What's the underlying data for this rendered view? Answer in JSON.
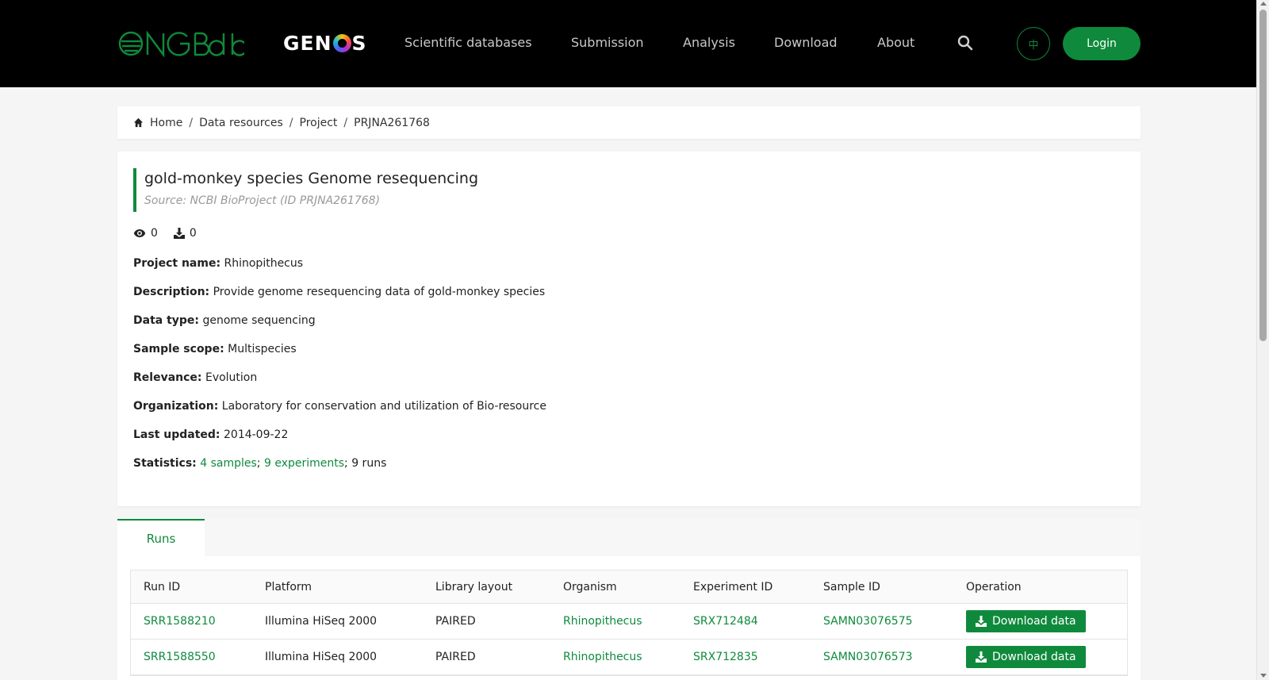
{
  "header": {
    "logo_text": "CNGBdb",
    "genos_left": "GEN",
    "genos_right": "S",
    "nav": [
      {
        "label": "Scientific databases"
      },
      {
        "label": "Submission"
      },
      {
        "label": "Analysis"
      },
      {
        "label": "Download"
      },
      {
        "label": "About"
      }
    ],
    "lang_label": "中",
    "login_label": "Login",
    "accent_color": "#0f8a3c"
  },
  "breadcrumb": [
    "Home",
    "Data resources",
    "Project",
    "PRJNA261768"
  ],
  "project": {
    "title": "gold-monkey species Genome resequencing",
    "source": "Source: NCBI BioProject (ID PRJNA261768)",
    "views": "0",
    "downloads": "0",
    "fields": [
      {
        "label": "Project name:",
        "value": "Rhinopithecus"
      },
      {
        "label": "Description:",
        "value": "Provide genome resequencing data of gold-monkey species"
      },
      {
        "label": "Data type:",
        "value": "genome sequencing"
      },
      {
        "label": "Sample scope:",
        "value": "Multispecies"
      },
      {
        "label": "Relevance:",
        "value": "Evolution"
      },
      {
        "label": "Organization:",
        "value": "Laboratory for conservation and utilization of Bio-resource"
      },
      {
        "label": "Last updated:",
        "value": "2014-09-22"
      }
    ],
    "statistics": {
      "label": "Statistics:",
      "samples": "4 samples",
      "experiments": "9 experiments",
      "runs": "9 runs",
      "sep": ";"
    }
  },
  "tabs": {
    "runs_label": "Runs"
  },
  "runs_table": {
    "headers": [
      "Run ID",
      "Platform",
      "Library layout",
      "Organism",
      "Experiment ID",
      "Sample ID",
      "Operation"
    ],
    "rows": [
      {
        "run_id": "SRR1588210",
        "platform": "Illumina HiSeq 2000",
        "layout": "PAIRED",
        "organism": "Rhinopithecus",
        "experiment_id": "SRX712484",
        "sample_id": "SAMN03076575",
        "operation": "Download data"
      },
      {
        "run_id": "SRR1588550",
        "platform": "Illumina HiSeq 2000",
        "layout": "PAIRED",
        "organism": "Rhinopithecus",
        "experiment_id": "SRX712835",
        "sample_id": "SAMN03076573",
        "operation": "Download data"
      }
    ]
  }
}
